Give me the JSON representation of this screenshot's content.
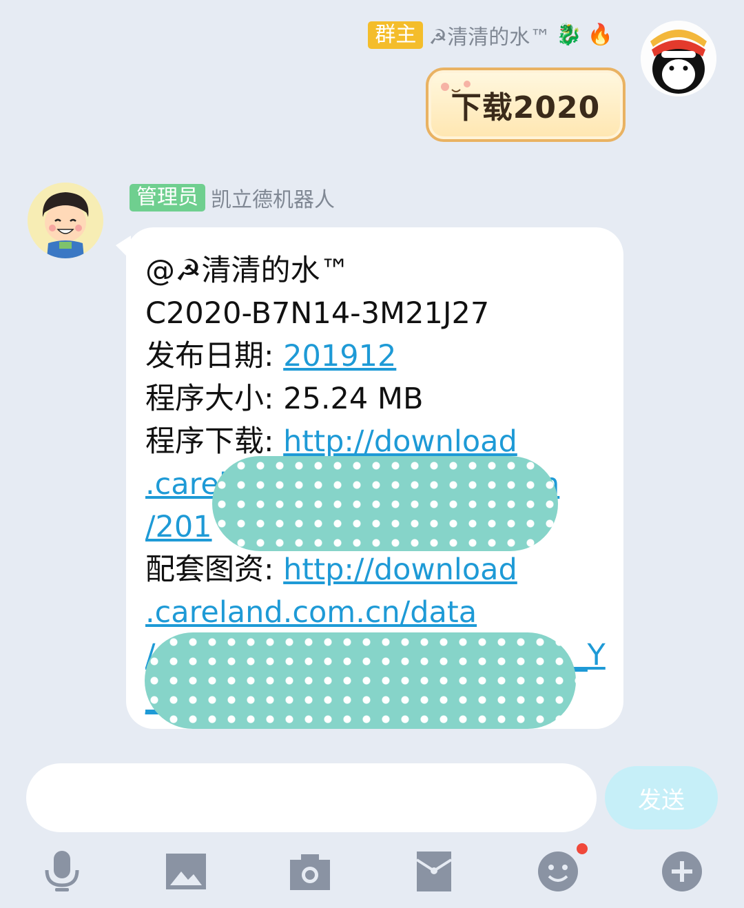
{
  "outgoing": {
    "role_badge": "群主",
    "sender_name": "☭清清的水™",
    "sender_emojis": [
      "🐉",
      "🔥"
    ],
    "sticker_text": "下载2020"
  },
  "incoming": {
    "role_badge": "管理员",
    "sender_name": "凯立德机器人",
    "mention": "@☭清清的水™",
    "code": "C2020-B7N14-3M21J27",
    "release_label": "发布日期: ",
    "release_value": "201912",
    "size_label": "程序大小: ",
    "size_value": "25.24 MB",
    "program_label": "程序下载: ",
    "program_link_1": "http://download",
    "program_link_2": ".carel",
    "program_link_2_tail": "n",
    "program_link_3": "/201",
    "assets_label": "配套图资: ",
    "assets_link_1": "http://download",
    "assets_link_2": ".careland.com.cn/data",
    "assets_link_3": "/",
    "assets_link_3_tail": "_Y",
    "assets_link_4": "_"
  },
  "input": {
    "placeholder": "",
    "send_label": "发送"
  },
  "toolbar": {
    "items": [
      "microphone-icon",
      "image-icon",
      "camera-icon",
      "red-packet-icon",
      "emoji-icon",
      "plus-icon"
    ],
    "emoji_has_notification": true
  },
  "colors": {
    "background": "#e6ebf3",
    "owner_badge": "#f4bd2b",
    "admin_badge": "#6fcf8f",
    "link": "#1e9ad6",
    "send_button": "#c6eff8",
    "redaction": "#86d4c9",
    "toolbar_icon": "#8a93a3",
    "notification_dot": "#f0483a"
  }
}
